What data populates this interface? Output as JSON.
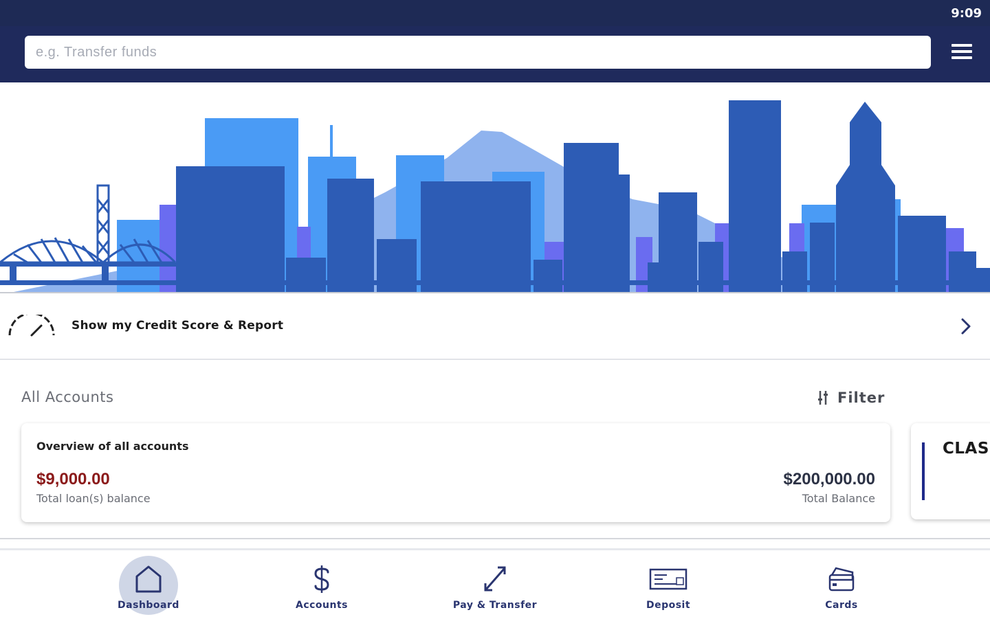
{
  "status_bar": {
    "time": "9:09"
  },
  "search": {
    "placeholder": "e.g. Transfer funds",
    "value": ""
  },
  "header": {
    "menu_icon": "hamburger-menu-icon"
  },
  "credit_banner": {
    "label": "Show my Credit Score & Report",
    "icon": "speedometer-gauge-icon",
    "chevron": "chevron-right-icon"
  },
  "accounts": {
    "section_title": "All Accounts",
    "filter_label": "Filter",
    "overview_card": {
      "title": "Overview of all accounts",
      "loan_balance": "$9,000.00",
      "loan_label": "Total loan(s) balance",
      "total_balance": "$200,000.00",
      "total_label": "Total Balance"
    },
    "next_card": {
      "title": "CLAS"
    }
  },
  "bottom_nav": {
    "items": [
      {
        "label": "Dashboard",
        "icon": "home-icon",
        "active": true
      },
      {
        "label": "Accounts",
        "icon": "dollar-icon",
        "active": false
      },
      {
        "label": "Pay & Transfer",
        "icon": "transfer-arrows-icon",
        "active": false
      },
      {
        "label": "Deposit",
        "icon": "check-deposit-icon",
        "active": false
      },
      {
        "label": "Cards",
        "icon": "cards-icon",
        "active": false
      }
    ]
  },
  "colors": {
    "header_bg": "#1f2a5c",
    "skyline_dark": "#2d5cb5",
    "skyline_mid": "#4a9bf5",
    "skyline_purple": "#6a6cf0",
    "skyline_light": "#8fb3ee",
    "loan_red": "#8b1a1a",
    "nav_active_bg": "#cfd6e6",
    "nav_text": "#2a3570"
  }
}
